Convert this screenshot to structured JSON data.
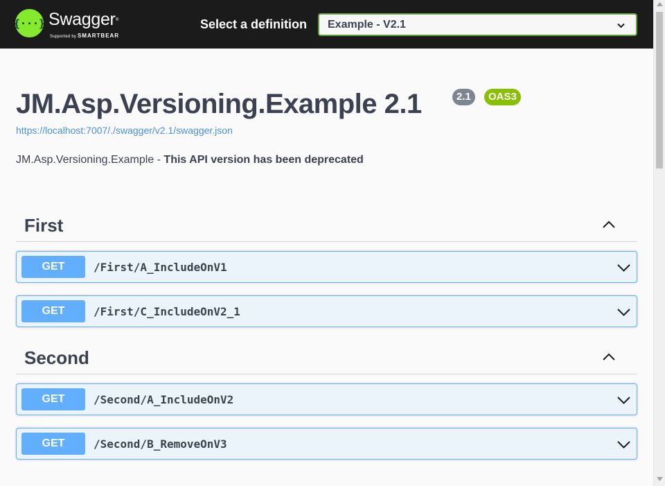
{
  "topbar": {
    "logo": {
      "icon": "swagger-logo-icon",
      "name": "Swagger",
      "supported_by": "Supported by",
      "company": "SMARTBEAR"
    },
    "definition_label": "Select a definition",
    "definition_selected": "Example - V2.1"
  },
  "info": {
    "title": "JM.Asp.Versioning.Example 2.1",
    "version_badge": "2.1",
    "oas_badge": "OAS3",
    "spec_url": "https://localhost:7007/./swagger/v2.1/swagger.json",
    "description_prefix": "JM.Asp.Versioning.Example - ",
    "description_bold": "This API version has been deprecated"
  },
  "tags": [
    {
      "name": "First",
      "expanded": true,
      "operations": [
        {
          "method": "GET",
          "path": "/First/A_IncludeOnV1"
        },
        {
          "method": "GET",
          "path": "/First/C_IncludeOnV2_1"
        }
      ]
    },
    {
      "name": "Second",
      "expanded": true,
      "operations": [
        {
          "method": "GET",
          "path": "/Second/A_IncludeOnV2"
        },
        {
          "method": "GET",
          "path": "/Second/B_RemoveOnV3"
        }
      ]
    }
  ],
  "colors": {
    "topbar": "#1b1b1b",
    "brand_green": "#85ea2d",
    "select_border": "#62a03f",
    "get_method": "#61affe",
    "get_bg": "#ebf3fb",
    "version_badge": "#7d8492",
    "oas_badge": "#89bf04",
    "link": "#4990e2"
  }
}
